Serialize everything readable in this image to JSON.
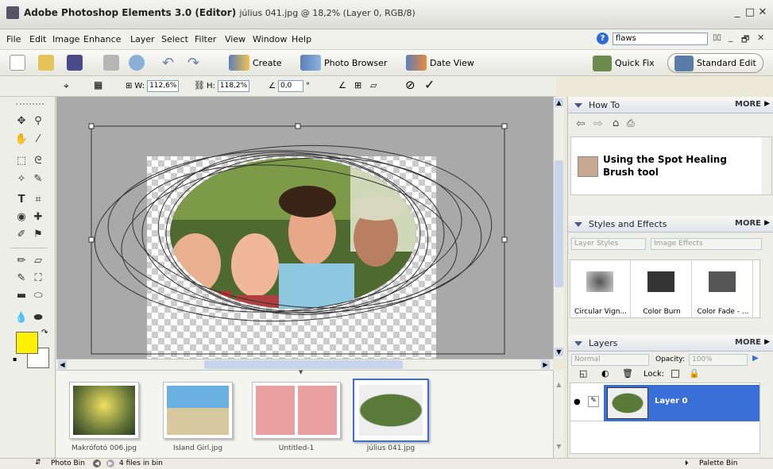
{
  "window": {
    "title": "Adobe Photoshop Elements 3.0 (Editor)",
    "subtitle": "július 041.jpg @ 18,2% (Layer 0, RGB/8)",
    "controls": [
      "_",
      "□",
      "✕"
    ]
  },
  "menu": [
    "File",
    "Edit",
    "Image",
    "Enhance",
    "Layer",
    "Select",
    "Filter",
    "View",
    "Window",
    "Help"
  ],
  "search": {
    "value": "flaws"
  },
  "doc_controls": [
    "▯▯",
    "_",
    "🗗",
    "✕"
  ],
  "toolbar": {
    "create": "Create",
    "photo_browser": "Photo Browser",
    "date_view": "Date View",
    "quick_fix": "Quick Fix",
    "standard_edit": "Standard Edit"
  },
  "options": {
    "w_label": "W:",
    "w_value": "112,6%",
    "h_label": "H:",
    "h_value": "118,2%",
    "angle_value": "0,0",
    "degree": "°"
  },
  "bin": {
    "items": [
      {
        "name": "Makrófotó 006.jpg"
      },
      {
        "name": "Island Girl.jpg"
      },
      {
        "name": "Untitled-1"
      },
      {
        "name": "július 041.jpg"
      }
    ],
    "label": "Photo Bin",
    "count": "4 files in bin"
  },
  "status": {
    "palette_bin": "Palette Bin"
  },
  "howto": {
    "title": "How To",
    "more": "MORE",
    "topic": "Using the Spot Healing Brush tool"
  },
  "styles": {
    "title": "Styles and Effects",
    "more": "MORE",
    "layer_styles": "Layer Styles",
    "image_effects": "Image Effects",
    "items": [
      {
        "label": "Circular Vign...",
        "color": "#7a7a7a"
      },
      {
        "label": "Color Burn",
        "color": "#333333"
      },
      {
        "label": "Color Fade - ...",
        "color": "#555555"
      }
    ]
  },
  "layers": {
    "title": "Layers",
    "more": "MORE",
    "blend": "Normal",
    "opacity_label": "Opacity:",
    "opacity_value": "100%",
    "lock_label": "Lock:",
    "layer_name": "Layer 0"
  },
  "colors": {
    "foreground": "#ffef00",
    "background": "#ffffff",
    "selection": "#3a6fd8",
    "palette_header": "#dfe3ea"
  }
}
